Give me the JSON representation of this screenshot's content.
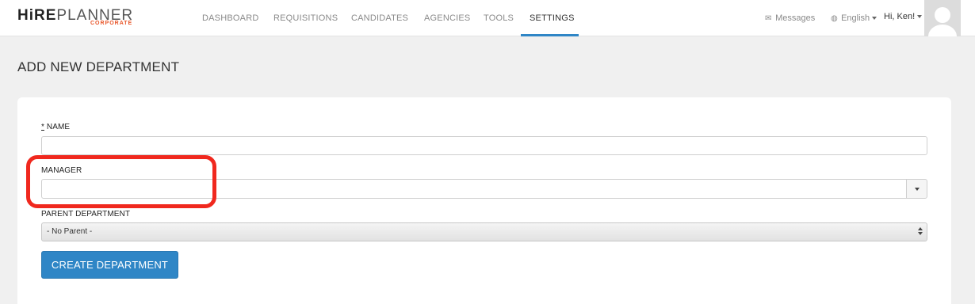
{
  "brand": {
    "hire": "HiRE",
    "planner": "PLANNER",
    "tagline": "CORPORATE",
    "accent_color": "#e8562a"
  },
  "nav": {
    "items": [
      {
        "label": "DASHBOARD"
      },
      {
        "label": "REQUISITIONS"
      },
      {
        "label": "CANDIDATES"
      },
      {
        "label": "AGENCIES"
      },
      {
        "label": "TOOLS"
      },
      {
        "label": "SETTINGS",
        "active": true
      }
    ],
    "active_color": "#2f86c6"
  },
  "header_right": {
    "messages": {
      "icon": "envelope-icon",
      "label": "Messages"
    },
    "language": {
      "icon": "globe-icon",
      "label": "English"
    },
    "greeting": "Hi, Ken!",
    "avatar_icon": "user-silhouette-icon"
  },
  "page": {
    "title": "ADD NEW DEPARTMENT"
  },
  "form": {
    "name": {
      "required_marker": "*",
      "label": "NAME",
      "value": ""
    },
    "manager": {
      "label": "MANAGER",
      "value": ""
    },
    "parent_department": {
      "label": "PARENT DEPARTMENT",
      "selected": "- No Parent -"
    },
    "submit_label": "CREATE DEPARTMENT",
    "button_color": "#2f86c6",
    "highlight_color": "#f0281e"
  }
}
